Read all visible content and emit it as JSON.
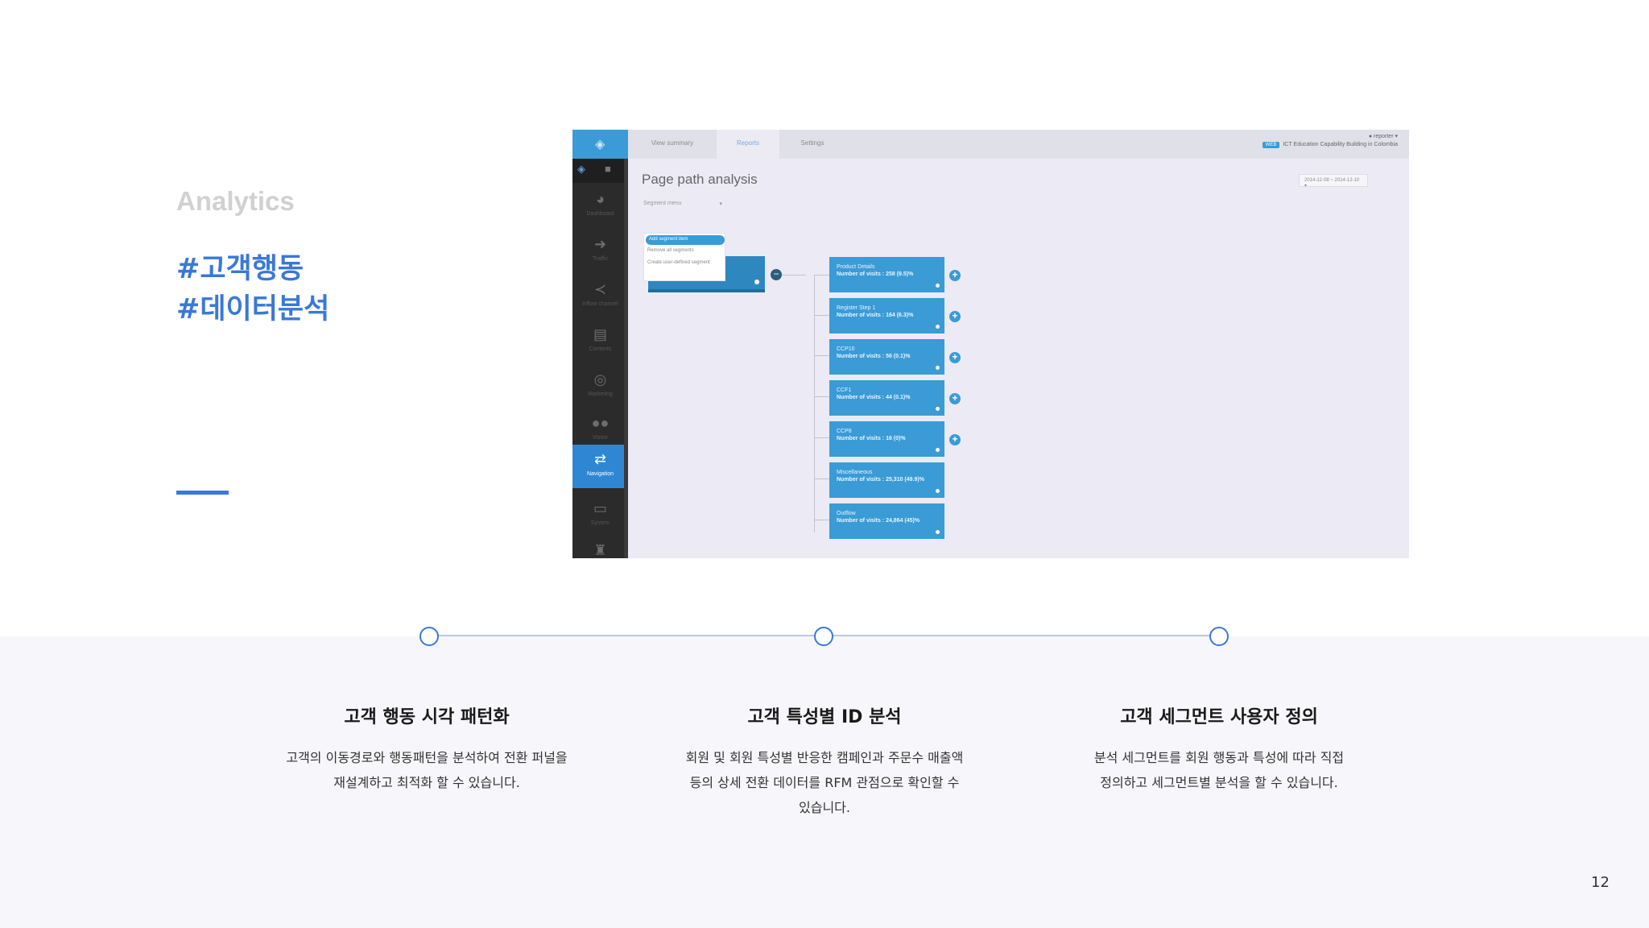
{
  "slide": {
    "brand": "Analytics",
    "tag1": "#고객행동",
    "tag2": "#데이터분석",
    "page_number": "12"
  },
  "app": {
    "tabs": [
      "View summary",
      "Reports",
      "Settings"
    ],
    "user": "reporter",
    "badge": "WEB",
    "org": "ICT Education Capability Building in Colombia",
    "page_title": "Page path analysis",
    "date_range": "2014-12-08 ~ 2014-12-10",
    "segment_menu_label": "Segment menu",
    "segment_menu_items": [
      "Add segment item",
      "Remove all segments",
      "Create user-defined segment"
    ],
    "sidebar": [
      "Dashboard",
      "Traffic",
      "Inflow channel",
      "Contents",
      "Marketing",
      "Visitor",
      "Navigation",
      "System"
    ],
    "nodes": [
      {
        "name": "Product Details",
        "visits": "Number of visits : 258 (9.5)%"
      },
      {
        "name": "Register Step 1",
        "visits": "Number of visits : 164 (6.3)%"
      },
      {
        "name": "CCP10",
        "visits": "Number of visits : 56 (0.1)%"
      },
      {
        "name": "CCF1",
        "visits": "Number of visits : 44 (0.1)%"
      },
      {
        "name": "CCP8",
        "visits": "Number of visits : 16 (0)%"
      },
      {
        "name": "Miscellaneous",
        "visits": "Number of visits : 25,310 (49.9)%"
      },
      {
        "name": "Outflow",
        "visits": "Number of visits : 24,864 (45)%"
      }
    ]
  },
  "features": [
    {
      "title": "고객 행동 시각 패턴화",
      "desc_lines": [
        "고객의 이동경로와 행동패턴을 분석하여 전환 퍼널을",
        "재설계하고 최적화 할 수 있습니다."
      ]
    },
    {
      "title": "고객 특성별 ID 분석",
      "desc_lines": [
        "회원 및 회원 특성별 반응한 캠페인과 주문수 매출액",
        "등의 상세 전환 데이터를 RFM 관점으로 확인할 수",
        "있습니다."
      ]
    },
    {
      "title": "고객 세그먼트 사용자 정의",
      "desc_lines": [
        "분석 세그먼트를 회원 행동과 특성에 따라 직접",
        "정의하고 세그먼트별 분석을 할 수 있습니다."
      ]
    }
  ]
}
